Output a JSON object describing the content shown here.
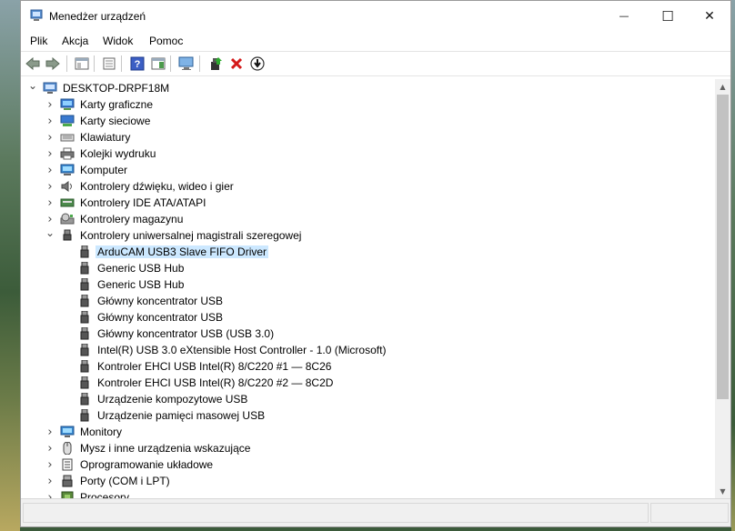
{
  "window": {
    "title": "Menedżer urządzeń",
    "minimize_glyph": "—",
    "maximize_glyph": "☐",
    "close_glyph": "✕"
  },
  "menu": [
    "Plik",
    "Akcja",
    "Widok",
    "Pomoc"
  ],
  "toolbar": {
    "buttons": [
      "back-icon",
      "forward-icon",
      "console-tree-icon",
      "properties-icon",
      "help-icon",
      "action-pane-icon",
      "scan-hardware-icon",
      "update-driver-icon",
      "uninstall-icon",
      "disable-icon"
    ]
  },
  "tree": {
    "root": "DESKTOP-DRPF18M",
    "categories_before": [
      {
        "label": "Karty graficzne",
        "icon": "display-adapter-icon"
      },
      {
        "label": "Karty sieciowe",
        "icon": "network-adapter-icon"
      },
      {
        "label": "Klawiatury",
        "icon": "keyboard-icon"
      },
      {
        "label": "Kolejki wydruku",
        "icon": "printer-icon"
      },
      {
        "label": "Komputer",
        "icon": "computer-icon"
      },
      {
        "label": "Kontrolery dźwięku, wideo i gier",
        "icon": "sound-icon"
      },
      {
        "label": "Kontrolery IDE ATA/ATAPI",
        "icon": "ide-icon"
      },
      {
        "label": "Kontrolery magazynu",
        "icon": "storage-icon"
      }
    ],
    "expanded_category": {
      "label": "Kontrolery uniwersalnej magistrali szeregowej",
      "icon": "usb-icon"
    },
    "usb_devices": [
      "ArduCAM USB3 Slave FIFO Driver",
      "Generic USB Hub",
      "Generic USB Hub",
      "Główny koncentrator USB",
      "Główny koncentrator USB",
      "Główny koncentrator USB (USB 3.0)",
      "Intel(R) USB 3.0 eXtensible Host Controller - 1.0 (Microsoft)",
      "Kontroler EHCI USB Intel(R) 8/C220 #1 — 8C26",
      "Kontroler EHCI USB Intel(R) 8/C220 #2 — 8C2D",
      "Urządzenie kompozytowe USB",
      "Urządzenie pamięci masowej USB"
    ],
    "selected_device": "ArduCAM USB3 Slave FIFO Driver",
    "categories_after": [
      {
        "label": "Monitory",
        "icon": "monitor-icon"
      },
      {
        "label": "Mysz i inne urządzenia wskazujące",
        "icon": "mouse-icon"
      },
      {
        "label": "Oprogramowanie układowe",
        "icon": "firmware-icon"
      },
      {
        "label": "Porty (COM i LPT)",
        "icon": "port-icon"
      },
      {
        "label": "Procesory",
        "icon": "processor-icon"
      }
    ]
  }
}
